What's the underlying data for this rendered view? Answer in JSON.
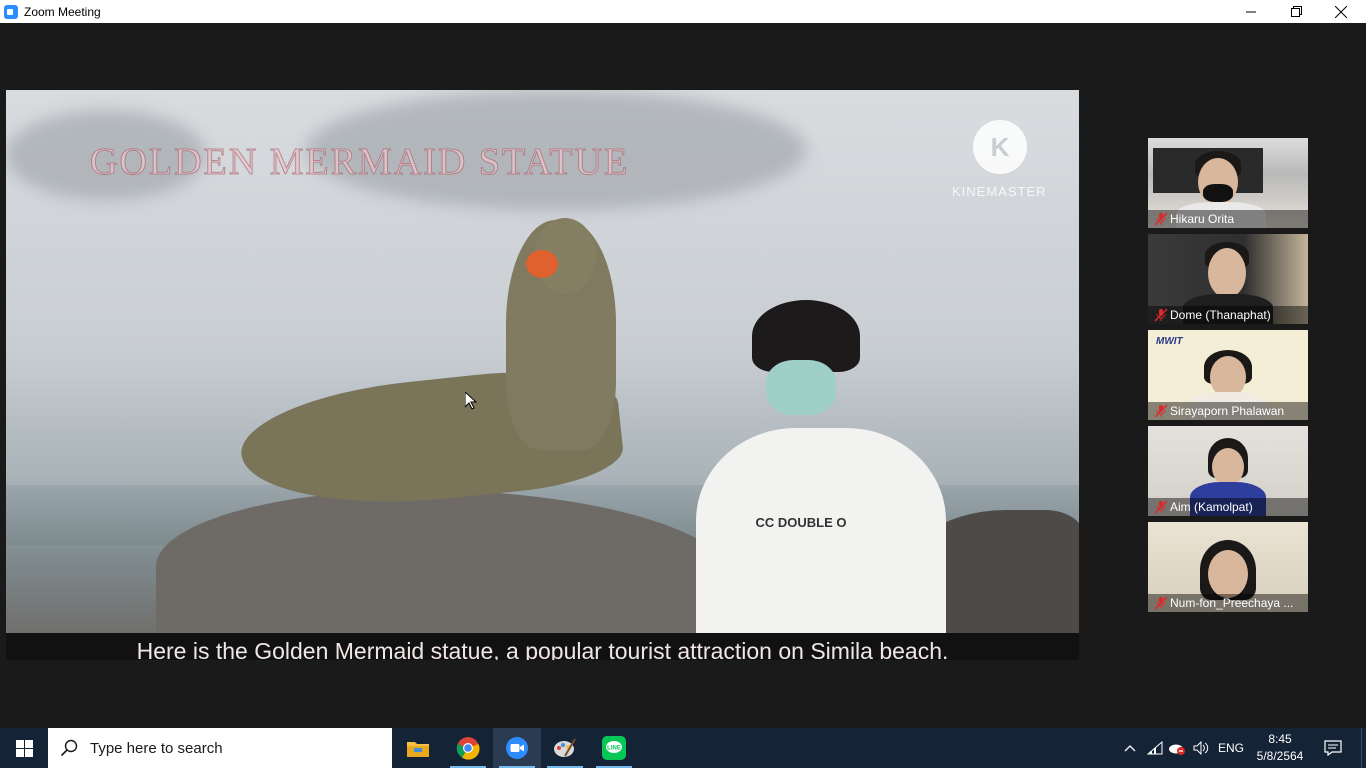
{
  "window": {
    "title": "Zoom Meeting",
    "icon": "zoom-app-icon",
    "controls": [
      "minimize-icon",
      "restore-icon",
      "close-icon"
    ]
  },
  "video": {
    "overlay_title": "GOLDEN MERMAID STATUE",
    "watermark_logo": "K",
    "watermark_text": "KINEMASTER",
    "shirt_text": "CC DOUBLE O",
    "caption": "Here is the Golden Mermaid statue, a popular tourist attraction on Simila beach."
  },
  "participants": [
    {
      "name": "Hikaru Orita",
      "muted": true
    },
    {
      "name": "Dome (Thanaphat)",
      "muted": true
    },
    {
      "name": "Sirayaporn Phalawan",
      "muted": true,
      "background_logo": "MWIT"
    },
    {
      "name": "Aim (Kamolpat)",
      "muted": true
    },
    {
      "name": "Num-fon_Preechaya ...",
      "muted": true
    }
  ],
  "taskbar": {
    "search_placeholder": "Type here to search",
    "apps": [
      "file-explorer-icon",
      "chrome-icon",
      "zoom-icon",
      "paint-icon",
      "line-icon"
    ],
    "active_app": "zoom-icon",
    "language": "ENG",
    "time": "8:45",
    "date": "5/8/2564"
  },
  "colors": {
    "zoom_blue": "#2d8cff",
    "taskbar": "#152336",
    "meeting_bg": "#1a1a1a",
    "muted_red": "#e02828",
    "line_green": "#06c755"
  }
}
